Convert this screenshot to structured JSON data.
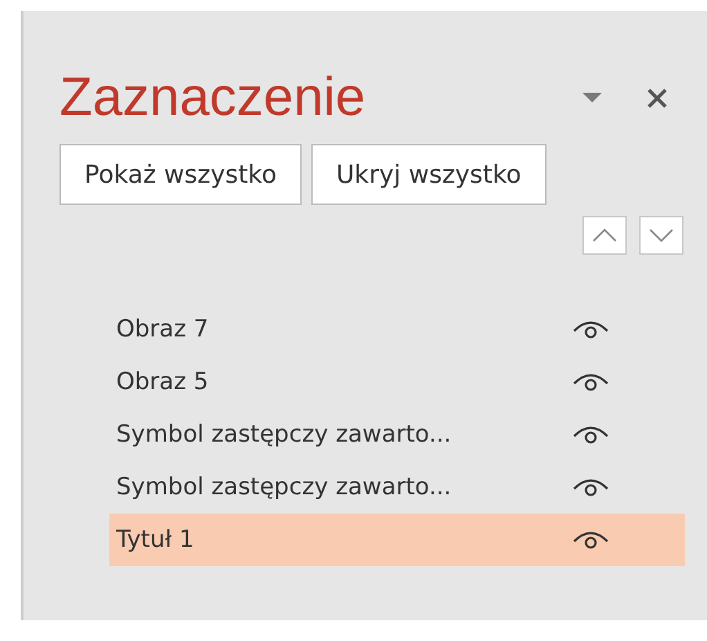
{
  "pane": {
    "title": "Zaznaczenie"
  },
  "buttons": [
    "Pokaż wszystko",
    "Ukryj wszystko"
  ],
  "items": [
    {
      "name": "Obraz 7",
      "visible": true,
      "selected": false
    },
    {
      "name": "Obraz 5",
      "visible": true,
      "selected": false
    },
    {
      "name": "Symbol zastępczy zawarto...",
      "visible": true,
      "selected": false
    },
    {
      "name": "Symbol zastępczy zawarto...",
      "visible": true,
      "selected": false
    },
    {
      "name": "Tytuł 1",
      "visible": true,
      "selected": true
    }
  ]
}
